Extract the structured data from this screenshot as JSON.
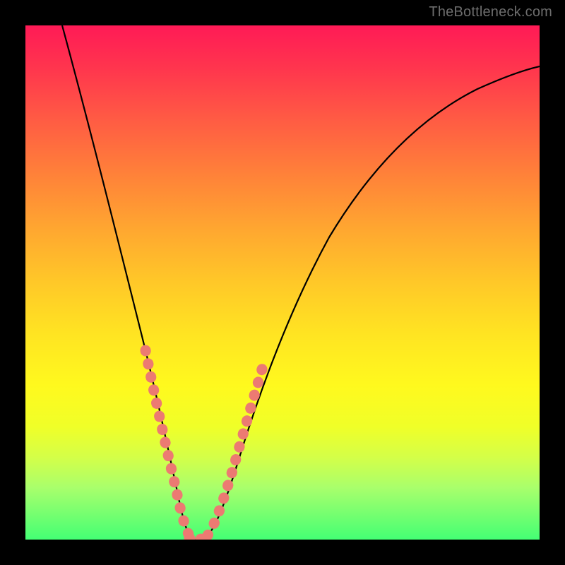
{
  "watermark": "TheBottleneck.com",
  "colors": {
    "gradient_top": "#ff1a56",
    "gradient_bottom": "#44ff74",
    "curve": "#000000",
    "dots": "#ec7a72",
    "background": "#000000"
  },
  "chart_data": {
    "type": "line",
    "title": "",
    "xlabel": "",
    "ylabel": "",
    "xlim": [
      0,
      100
    ],
    "ylim": [
      0,
      100
    ],
    "series": [
      {
        "name": "bottleneck-curve",
        "x": [
          7,
          10,
          13,
          16,
          19,
          22,
          24,
          26,
          28,
          29.5,
          31,
          33,
          36,
          40,
          45,
          50,
          55,
          60,
          65,
          70,
          75,
          80,
          85,
          90,
          95,
          100
        ],
        "y": [
          100,
          88,
          76,
          64,
          52,
          40,
          30,
          20,
          10,
          3,
          0,
          2,
          10,
          22,
          37,
          48,
          56,
          63,
          68,
          73,
          77,
          80,
          82.5,
          84.5,
          86,
          87
        ]
      }
    ],
    "markers": {
      "name": "highlight-dots",
      "x": [
        22,
        23,
        24,
        25,
        26,
        27,
        28,
        29,
        30,
        31,
        32,
        33,
        34,
        35,
        36,
        37,
        38,
        39,
        40,
        41
      ],
      "y": [
        40,
        35,
        30,
        24,
        18,
        12,
        7,
        3,
        1,
        0,
        1,
        3,
        6,
        10,
        14,
        18,
        22,
        26,
        30,
        34
      ]
    }
  }
}
